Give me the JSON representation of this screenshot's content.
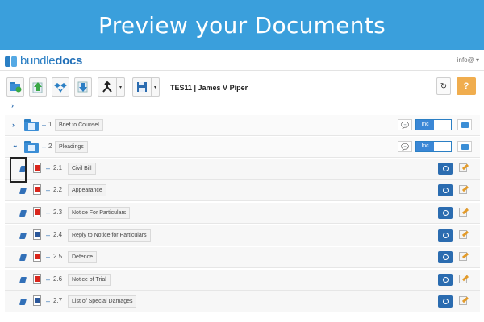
{
  "banner": {
    "title": "Preview your Documents"
  },
  "app": {
    "logo": {
      "prefix": "bundle",
      "suffix": "docs"
    },
    "info_menu": "info@ ▾",
    "case_title": "TES11 | James V Piper",
    "toolbar": {
      "refresh_symbol": "↻",
      "help_symbol": "?"
    }
  },
  "tabs": [
    {
      "number": "1",
      "label": "Brief to Counsel",
      "toggle": "Inc",
      "expanded": false
    },
    {
      "number": "2",
      "label": "Pleadings",
      "toggle": "Inc",
      "expanded": true
    }
  ],
  "documents": [
    {
      "number": "2.1",
      "label": "Civil Bill",
      "file_type": "pdf"
    },
    {
      "number": "2.2",
      "label": "Appearance",
      "file_type": "pdf"
    },
    {
      "number": "2.3",
      "label": "Notice For Particulars",
      "file_type": "pdf"
    },
    {
      "number": "2.4",
      "label": "Reply to Notice for Particulars",
      "file_type": "word"
    },
    {
      "number": "2.5",
      "label": "Defence",
      "file_type": "pdf"
    },
    {
      "number": "2.6",
      "label": "Notice of Trial",
      "file_type": "pdf"
    },
    {
      "number": "2.7",
      "label": "List of Special Damages",
      "file_type": "word"
    }
  ],
  "symbols": {
    "dash": "–",
    "chev_right": "›",
    "chev_down": "⌄",
    "comment": "💬",
    "caret": "▾"
  },
  "colors": {
    "banner": "#3a9fdc",
    "primary": "#2b6cb0",
    "help": "#f0ad4e",
    "pdf": "#d9261c",
    "word": "#2b579a"
  }
}
